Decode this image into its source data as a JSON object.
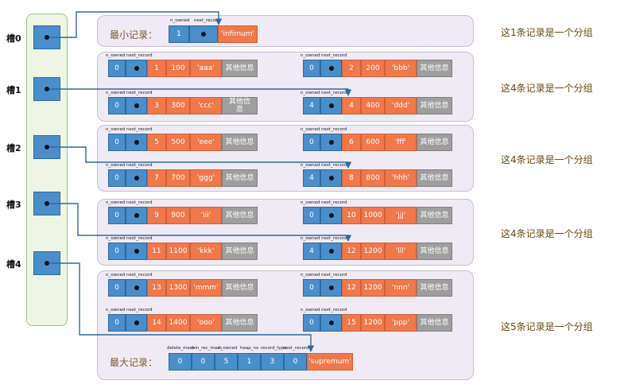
{
  "slots": [
    {
      "label": "槽0"
    },
    {
      "label": "槽1"
    },
    {
      "label": "槽2"
    },
    {
      "label": "槽3"
    },
    {
      "label": "槽4"
    }
  ],
  "header_labels": {
    "n_owned": "n_owned",
    "next_record": "next_record",
    "delete_mask": "delete_mask",
    "min_rec_mask": "min_rec_mask",
    "heap_no": "heap_no",
    "record_type": "record_type"
  },
  "infimum": {
    "label": "最小记录：",
    "n_owned": "1",
    "value": "'infimum'"
  },
  "supremum": {
    "label": "最大记录：",
    "delete_mask": "0",
    "min_rec_mask": "0",
    "n_owned": "5",
    "heap_no": "1",
    "record_type": "3",
    "next_record": "0",
    "value": "'supremum'"
  },
  "other_info": "其他信息",
  "other_info_wrapped": "其他信\n息",
  "records": [
    {
      "n_owned": "0",
      "a": "1",
      "b": "100",
      "c": "'aaa'"
    },
    {
      "n_owned": "0",
      "a": "2",
      "b": "200",
      "c": "'bbb'"
    },
    {
      "n_owned": "0",
      "a": "3",
      "b": "300",
      "c": "'ccc'"
    },
    {
      "n_owned": "4",
      "a": "4",
      "b": "400",
      "c": "'ddd'"
    },
    {
      "n_owned": "0",
      "a": "5",
      "b": "500",
      "c": "'eee'"
    },
    {
      "n_owned": "0",
      "a": "6",
      "b": "600",
      "c": "'fff'"
    },
    {
      "n_owned": "0",
      "a": "7",
      "b": "700",
      "c": "'ggg'"
    },
    {
      "n_owned": "4",
      "a": "8",
      "b": "800",
      "c": "'hhh'"
    },
    {
      "n_owned": "0",
      "a": "9",
      "b": "900",
      "c": "'iii'"
    },
    {
      "n_owned": "0",
      "a": "10",
      "b": "1000",
      "c": "'jjj'"
    },
    {
      "n_owned": "0",
      "a": "11",
      "b": "1100",
      "c": "'kkk'"
    },
    {
      "n_owned": "4",
      "a": "12",
      "b": "1200",
      "c": "'lll'"
    },
    {
      "n_owned": "0",
      "a": "13",
      "b": "1300",
      "c": "'mmm'"
    },
    {
      "n_owned": "0",
      "a": "12",
      "b": "1200",
      "c": "'nnn'"
    },
    {
      "n_owned": "0",
      "a": "14",
      "b": "1400",
      "c": "'ooo'"
    },
    {
      "n_owned": "0",
      "a": "15",
      "b": "1200",
      "c": "'ppp'"
    }
  ],
  "group_notes": [
    "这1条记录是一个分组",
    "这4条记录是一个分组",
    "这4条记录是一个分组",
    "这4条记录是一个分组",
    "这5条记录是一个分组"
  ],
  "colors": {
    "blue": "#4a8ecb",
    "orange": "#f0784a",
    "gray": "#9e9e9e",
    "group_bg": "#f0eaf5",
    "slot_bg": "#eef5e4",
    "arrow": "#2e6a9e"
  }
}
